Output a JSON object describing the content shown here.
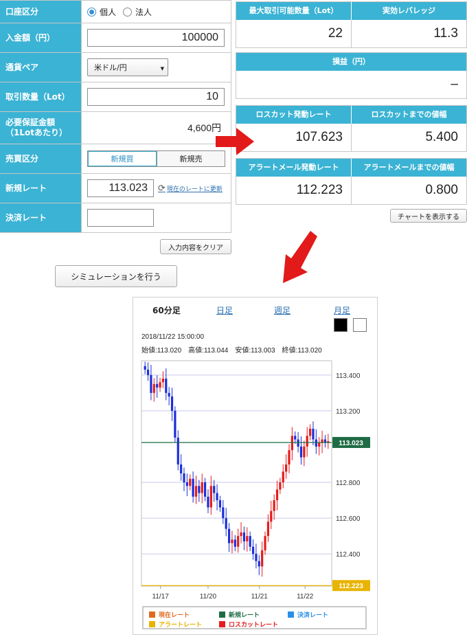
{
  "form": {
    "account_type": {
      "label": "口座区分",
      "options": [
        "個人",
        "法人"
      ],
      "selected": 0
    },
    "deposit": {
      "label": "入金額（円）",
      "value": "100000"
    },
    "currency_pair": {
      "label": "通貨ペア",
      "value": "米ドル/円"
    },
    "lot": {
      "label": "取引数量（Lot）",
      "value": "10"
    },
    "margin": {
      "label1": "必要保証金額",
      "label2": "（1Lotあたり）",
      "value": "4,600円"
    },
    "side": {
      "label": "売買区分",
      "buy": "新規買",
      "sell": "新規売"
    },
    "entry_rate": {
      "label": "新規レート",
      "value": "113.023",
      "refresh": "現在のレートに更新"
    },
    "settle_rate": {
      "label": "決済レート",
      "value": ""
    },
    "clear_button": "入力内容をクリア",
    "simulate_button": "シミュレーションを行う"
  },
  "results": {
    "max_lot": {
      "label": "最大取引可能数量（Lot）",
      "value": "22"
    },
    "leverage": {
      "label": "実効レバレッジ",
      "value": "11.3"
    },
    "pnl": {
      "label": "損益（円）",
      "value": "–"
    },
    "losscut_rate": {
      "label": "ロスカット発動レート",
      "value": "107.623"
    },
    "losscut_width": {
      "label": "ロスカットまでの値幅",
      "value": "5.400"
    },
    "alert_rate": {
      "label": "アラートメール発動レート",
      "value": "112.223"
    },
    "alert_width": {
      "label": "アラートメールまでの値幅",
      "value": "0.800"
    },
    "chart_button": "チャートを表示する"
  },
  "chart": {
    "tabs": [
      "60分足",
      "日足",
      "週足",
      "月足"
    ],
    "active_tab": 0,
    "datetime": "2018/11/22 15:00:00",
    "ohlc": "始値:113.020　高値:113.044　安値:113.003　終値:113.020",
    "legend": [
      {
        "label": "現在レート",
        "color": "#e06a1f"
      },
      {
        "label": "新規レート",
        "color": "#1f6b45"
      },
      {
        "label": "決済レート",
        "color": "#2a8ee8"
      },
      {
        "label": "アラートレート",
        "color": "#e8b400"
      },
      {
        "label": "ロスカットレート",
        "color": "#e61b1b"
      }
    ]
  },
  "chart_data": {
    "type": "candlestick",
    "interval": "60分足",
    "y_ticks": [
      "113.400",
      "113.200",
      "112.800",
      "112.600",
      "112.400"
    ],
    "x_ticks": [
      "11/17",
      "11/20",
      "11/21",
      "11/22"
    ],
    "ylim": [
      112.22,
      113.48
    ],
    "markers": [
      {
        "label": "113.023",
        "value": 113.023,
        "color": "#1f6b45"
      },
      {
        "label": "112.223",
        "value": 112.223,
        "color": "#e8b400"
      }
    ],
    "series_close": [
      113.43,
      113.4,
      113.3,
      113.35,
      113.33,
      113.36,
      113.38,
      113.3,
      113.28,
      113.2,
      113.05,
      112.9,
      112.85,
      112.8,
      112.78,
      112.82,
      112.72,
      112.78,
      112.74,
      112.8,
      112.72,
      112.66,
      112.78,
      112.74,
      112.7,
      112.66,
      112.6,
      112.54,
      112.46,
      112.48,
      112.44,
      112.5,
      112.52,
      112.47,
      112.5,
      112.44,
      112.4,
      112.36,
      112.33,
      112.42,
      112.5,
      112.58,
      112.64,
      112.7,
      112.76,
      112.8,
      112.86,
      112.9,
      112.98,
      113.06,
      113.04,
      113.0,
      112.94,
      113.0,
      113.06,
      113.1,
      113.04,
      113.0,
      113.02,
      113.04,
      113.02,
      113.03
    ]
  }
}
